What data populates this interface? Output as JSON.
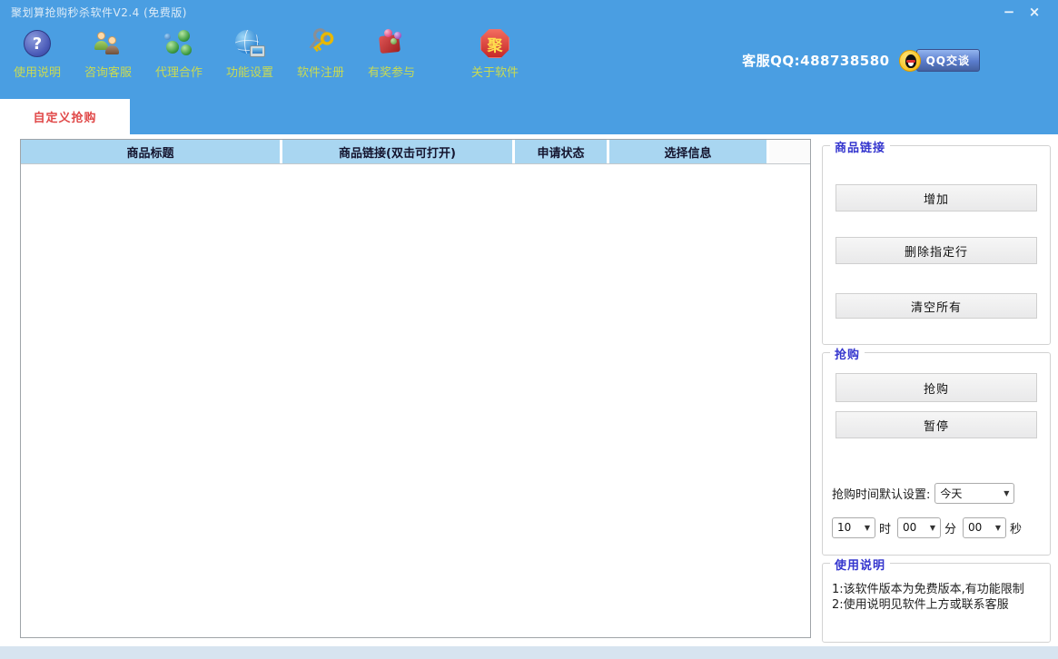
{
  "window": {
    "title": "聚划算抢购秒杀软件V2.4 (免费版)",
    "minimize_label": "−",
    "close_label": "×"
  },
  "toolbar": {
    "items": [
      {
        "label": "使用说明",
        "icon": "help-icon"
      },
      {
        "label": "咨询客服",
        "icon": "customer-service-icon"
      },
      {
        "label": "代理合作",
        "icon": "agent-cooperation-icon"
      },
      {
        "label": "功能设置",
        "icon": "settings-icon"
      },
      {
        "label": "软件注册",
        "icon": "software-register-icon"
      },
      {
        "label": "有奖参与",
        "icon": "prize-icon"
      },
      {
        "label": "关于软件",
        "icon": "about-icon"
      }
    ],
    "help_icon_glyph": "?",
    "about_icon_glyph": "聚",
    "qq_label": "客服QQ:488738580",
    "qq_button_label": "QQ交谈"
  },
  "tabs": {
    "custom_buy": "自定义抢购"
  },
  "table": {
    "headers": [
      "商品标题",
      "商品链接(双击可打开)",
      "申请状态",
      "选择信息"
    ],
    "rows": []
  },
  "panel": {
    "link_group": {
      "title": "商品链接",
      "add_button": "增加",
      "delete_row_button": "删除指定行",
      "clear_all_button": "清空所有"
    },
    "buy_group": {
      "title": "抢购",
      "buy_button": "抢购",
      "pause_button": "暂停",
      "time_default_label": "抢购时间默认设置:",
      "day_value": "今天",
      "hour_value": "10",
      "hour_unit": "时",
      "minute_value": "00",
      "minute_unit": "分",
      "second_value": "00",
      "second_unit": "秒",
      "dropdown_arrow": "▼"
    },
    "help_group": {
      "title": "使用说明",
      "line1": "1:该软件版本为免费版本,有功能限制",
      "line2": "2:使用说明见软件上方或联系客服"
    }
  },
  "colors": {
    "header_blue": "#4A9EE2",
    "tab_text_red": "#E04848",
    "group_title_blue": "#3536CE",
    "toolbar_label_green": "#C9DB52",
    "table_header_bg": "#A9D6F1"
  }
}
